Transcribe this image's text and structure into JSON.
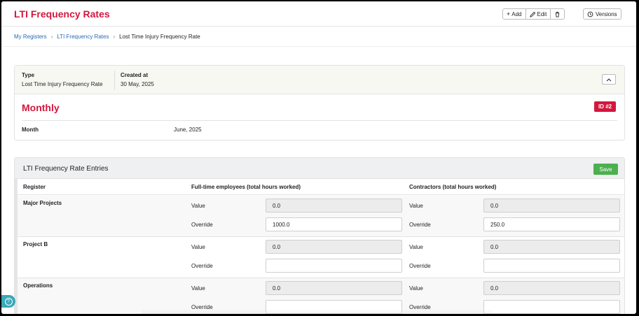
{
  "header": {
    "title": "LTI Frequency Rates",
    "add_label": "Add",
    "edit_label": "Edit",
    "versions_label": "Versions"
  },
  "breadcrumb": {
    "items": [
      "My Registers",
      "LTI Frequency Rates",
      "Lost Time Injury Frequency Rate"
    ],
    "separator": "›"
  },
  "summary": {
    "type_label": "Type",
    "type_value": "Lost Time Injury Frequency Rate",
    "created_label": "Created at",
    "created_value": "30 May, 2025",
    "record_title": "Monthly",
    "id_badge": "ID #2",
    "month_label": "Month",
    "month_value": "June, 2025"
  },
  "entries": {
    "title": "LTI Frequency Rate Entries",
    "save_label": "Save",
    "columns": [
      "Register",
      "Full-time employees (total hours worked)",
      "Contractors (total hours worked)"
    ],
    "value_label": "Value",
    "override_label": "Override",
    "rows": [
      {
        "register": "Major Projects",
        "ft_value": "0.0",
        "ft_override": "1000.0",
        "ct_value": "0.0",
        "ct_override": "250.0"
      },
      {
        "register": "Project B",
        "ft_value": "0.0",
        "ft_override": "",
        "ct_value": "0.0",
        "ct_override": ""
      },
      {
        "register": "Operations",
        "ft_value": "0.0",
        "ft_override": "",
        "ct_value": "0.0",
        "ct_override": ""
      }
    ]
  },
  "colors": {
    "brand": "#d3173d",
    "link": "#2a6bb5",
    "save": "#4caf50",
    "help": "#3aa9b9"
  },
  "icons": {
    "add": "plus-icon",
    "edit": "pencil-icon",
    "delete": "trash-icon",
    "versions": "history-icon",
    "collapse": "chevron-up-icon",
    "help": "help-icon"
  }
}
